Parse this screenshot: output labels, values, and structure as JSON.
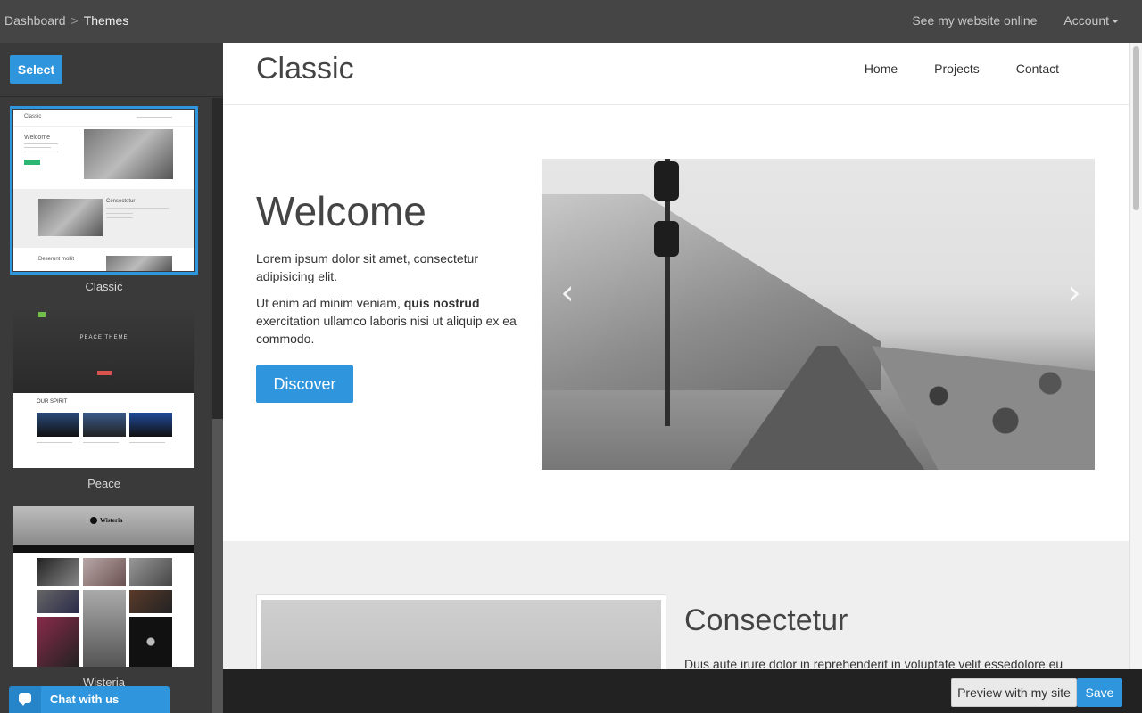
{
  "topbar": {
    "breadcrumb": [
      "Dashboard",
      "Themes"
    ],
    "separator": ">",
    "see_site": "See my website online",
    "account": "Account"
  },
  "sidebar": {
    "select_label": "Select",
    "themes": [
      {
        "name": "Classic",
        "active": true
      },
      {
        "name": "Peace",
        "active": false
      },
      {
        "name": "Wisteria",
        "active": false
      }
    ],
    "thumb_classic": {
      "title": "Classic",
      "welcome": "Welcome",
      "section": "Consectetur",
      "section2": "Deserunt mollit"
    },
    "thumb_peace": {
      "title": "PEACE THEME",
      "subtitle": "OUR SPIRIT"
    },
    "thumb_wisteria": {
      "title": "Wisteria"
    },
    "chat_label": "Chat with us"
  },
  "preview": {
    "site_title": "Classic",
    "nav": [
      "Home",
      "Projects",
      "Contact"
    ],
    "hero": {
      "heading": "Welcome",
      "p1": "Lorem ipsum dolor sit amet, consectetur adipisicing elit.",
      "p2_pre": "Ut enim ad minim veniam, ",
      "p2_bold": "quis nostrud",
      "p2_post": " exercitation ullamco laboris nisi ut aliquip ex ea commodo.",
      "button": "Discover",
      "arrow_left": "‹",
      "arrow_right": "›"
    },
    "second": {
      "heading": "Consectetur",
      "text": "Duis aute irure dolor in reprehenderit in voluptate velit essedolore eu"
    }
  },
  "bottombar": {
    "preview_label": "Preview with my site",
    "save_label": "Save"
  },
  "colors": {
    "accent": "#2f95dc",
    "topbar": "#454545",
    "sidebar": "#3a3a3a",
    "bottombar": "#222222"
  }
}
